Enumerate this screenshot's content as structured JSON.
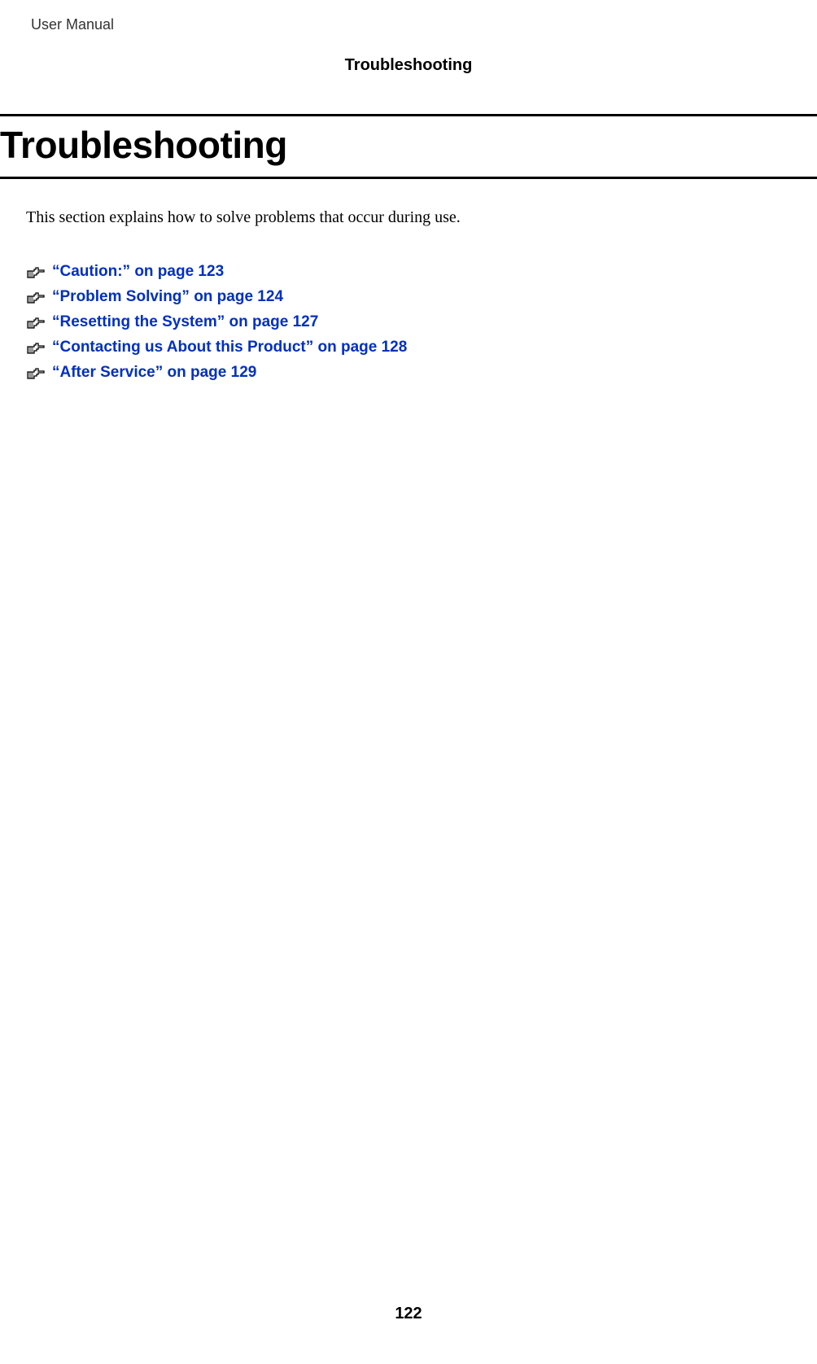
{
  "header": {
    "top_left": "User Manual",
    "section_label": "Troubleshooting"
  },
  "main": {
    "heading": "Troubleshooting",
    "intro": "This section explains how to solve problems that occur during use."
  },
  "links": [
    {
      "text": "“Caution:” on page 123"
    },
    {
      "text": "“Problem Solving” on page 124"
    },
    {
      "text": "“Resetting the System” on page 127"
    },
    {
      "text": "“Contacting us About this Product” on page 128"
    },
    {
      "text": "“After Service” on page 129"
    }
  ],
  "footer": {
    "page_number": "122"
  }
}
